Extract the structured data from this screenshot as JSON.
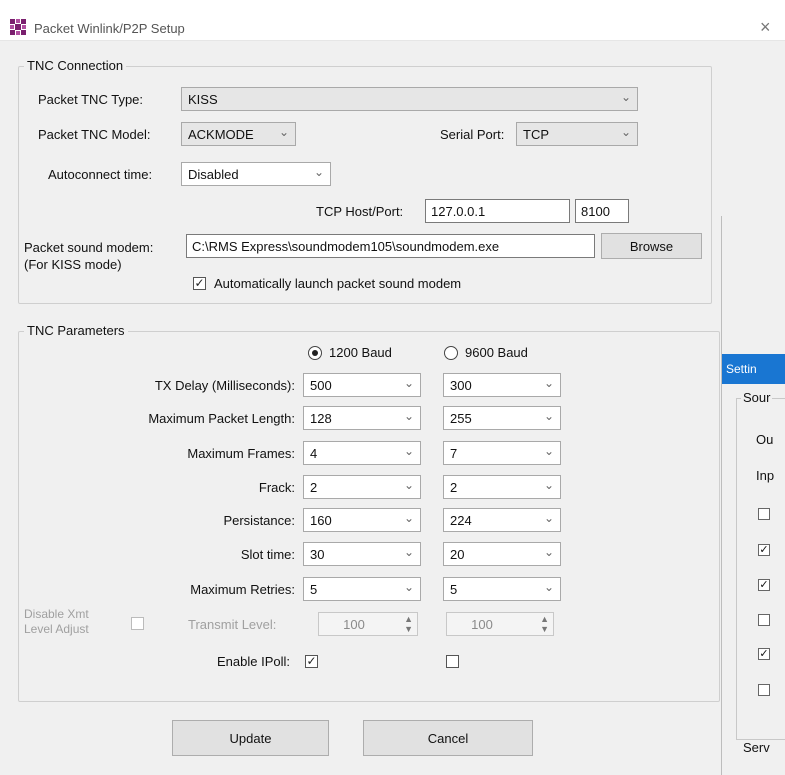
{
  "window": {
    "title": "Packet Winlink/P2P Setup",
    "close": "×"
  },
  "tnc_connection": {
    "legend": "TNC Connection",
    "type_label": "Packet TNC Type:",
    "type_value": "KISS",
    "model_label": "Packet TNC Model:",
    "model_value": "ACKMODE",
    "serial_label": "Serial Port:",
    "serial_value": "TCP",
    "autoconnect_label": "Autoconnect time:",
    "autoconnect_value": "Disabled",
    "host_label": "TCP Host/Port:",
    "host_value": "127.0.0.1",
    "port_value": "8100",
    "modem_label": "Packet sound modem:",
    "modem_sub": "(For KISS mode)",
    "modem_path": "C:\\RMS Express\\soundmodem105\\soundmodem.exe",
    "browse_label": "Browse",
    "autolaunch_label": "Automatically launch packet sound modem",
    "autolaunch_checked": true
  },
  "tnc_parameters": {
    "legend": "TNC Parameters",
    "baud_1200": "1200 Baud",
    "baud_9600": "9600 Baud",
    "selected_baud": "1200",
    "rows": [
      {
        "label": "TX Delay (Milliseconds):",
        "v1200": "500",
        "v9600": "300"
      },
      {
        "label": "Maximum Packet Length:",
        "v1200": "128",
        "v9600": "255"
      },
      {
        "label": "Maximum Frames:",
        "v1200": "4",
        "v9600": "7"
      },
      {
        "label": "Frack:",
        "v1200": "2",
        "v9600": "2"
      },
      {
        "label": "Persistance:",
        "v1200": "160",
        "v9600": "224"
      },
      {
        "label": "Slot time:",
        "v1200": "30",
        "v9600": "20"
      },
      {
        "label": "Maximum Retries:",
        "v1200": "5",
        "v9600": "5"
      }
    ],
    "disable_xmit_line1": "Disable Xmt",
    "disable_xmit_line2": "Level Adjust",
    "transmit_level_label": "Transmit Level:",
    "transmit_1200": "100",
    "transmit_9600": "100",
    "ipoll_label": "Enable IPoll:",
    "ipoll_1200": true,
    "ipoll_9600": false
  },
  "buttons": {
    "update": "Update",
    "cancel": "Cancel"
  },
  "settings_window": {
    "title": "Settin",
    "group1": "Sour",
    "item_out": "Ou",
    "item_inp": "Inp",
    "checks": [
      false,
      true,
      true,
      false,
      true,
      false
    ],
    "group2": "Serv"
  },
  "icons": {
    "app": "winlink-logo-icon",
    "dropdown": "chevron-down-icon",
    "check": "checkmark-icon"
  },
  "colors": {
    "dialog_bg": "#f0f0f0",
    "settings_title_bg": "#1976d2"
  }
}
